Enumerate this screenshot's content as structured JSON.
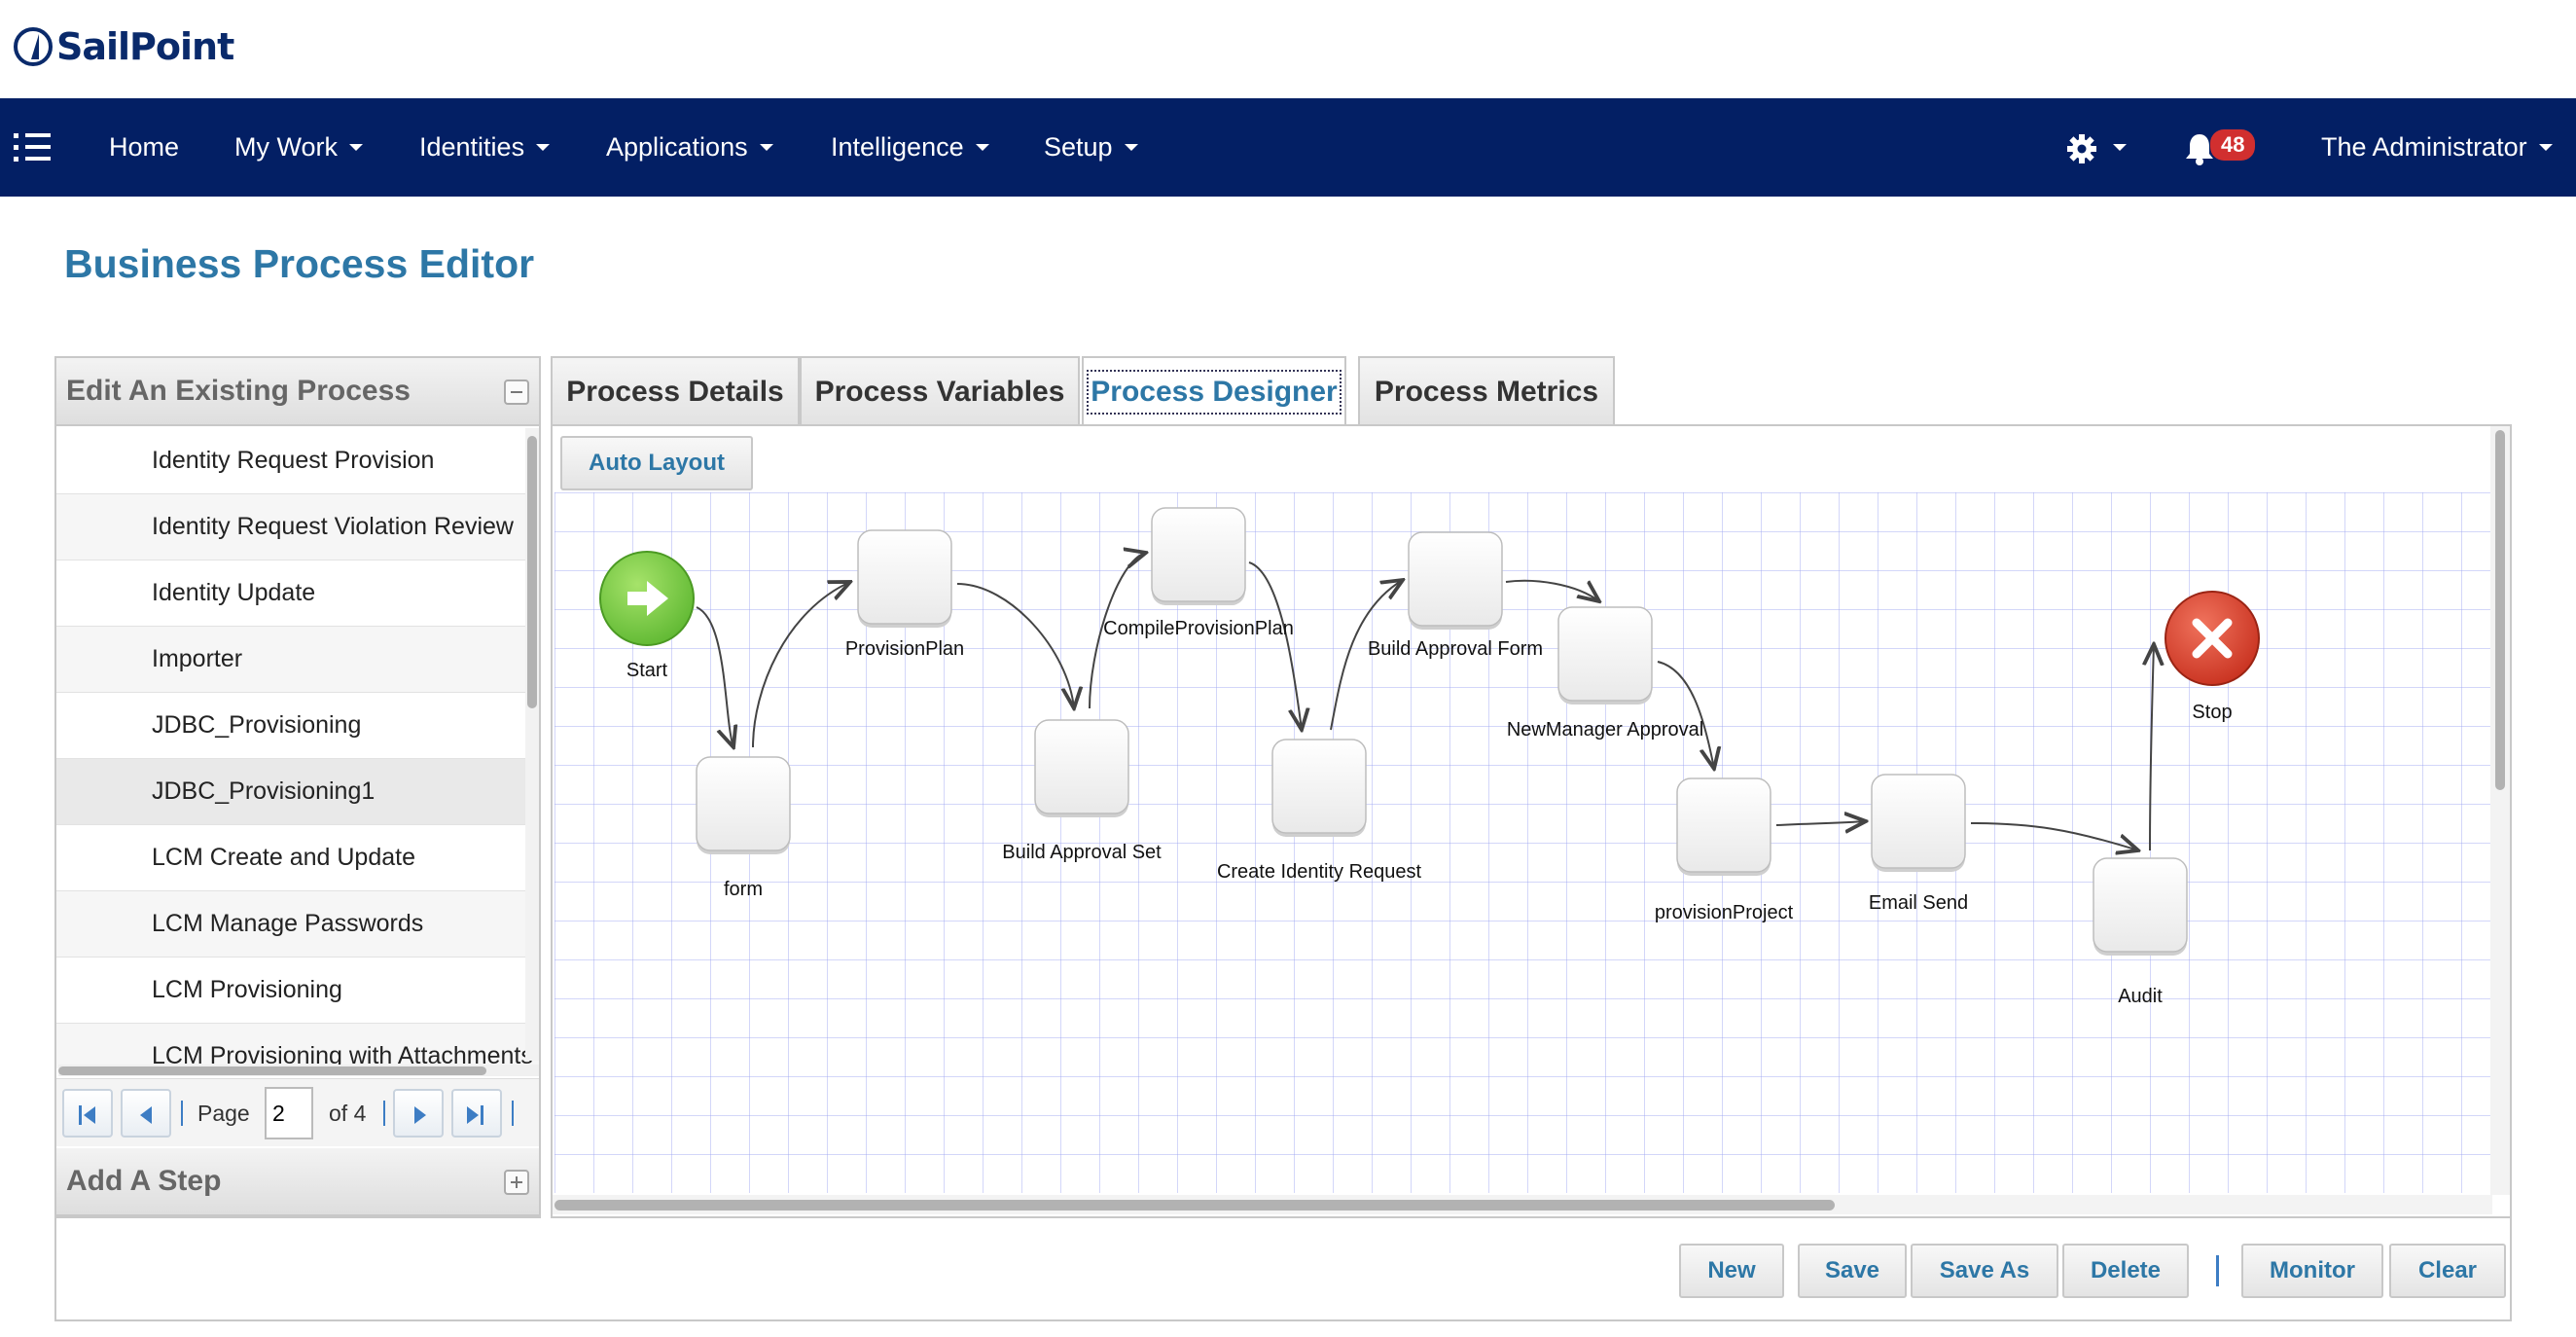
{
  "brand": {
    "name": "SailPoint"
  },
  "nav": {
    "items": [
      {
        "label": "Home",
        "has_dropdown": false
      },
      {
        "label": "My Work",
        "has_dropdown": true
      },
      {
        "label": "Identities",
        "has_dropdown": true
      },
      {
        "label": "Applications",
        "has_dropdown": true
      },
      {
        "label": "Intelligence",
        "has_dropdown": true
      },
      {
        "label": "Setup",
        "has_dropdown": true
      }
    ],
    "notifications_count": "48",
    "user": "The Administrator",
    "icons": [
      "menu-list-icon",
      "gear-icon",
      "bell-icon"
    ]
  },
  "page": {
    "title": "Business Process Editor"
  },
  "left_panel": {
    "edit_header": "Edit An Existing Process",
    "processes": [
      "Identity Request Provision",
      "Identity Request Violation Review",
      "Identity Update",
      "Importer",
      "JDBC_Provisioning",
      "JDBC_Provisioning1",
      "LCM Create and Update",
      "LCM Manage Passwords",
      "LCM Provisioning",
      "LCM Provisioning with Attachments"
    ],
    "selected_index": 5,
    "pager": {
      "page_label": "Page",
      "page_value": "2",
      "of_label": "of 4"
    },
    "add_step_header": "Add A Step"
  },
  "tabs": [
    {
      "label": "Process Details",
      "active": false
    },
    {
      "label": "Process Variables",
      "active": false
    },
    {
      "label": "Process Designer",
      "active": true
    },
    {
      "label": "Process Metrics",
      "active": false
    }
  ],
  "designer": {
    "auto_layout_label": "Auto Layout",
    "colors": {
      "start": "#5fb832",
      "stop": "#c8311f",
      "node": "#e9e9e9",
      "edge": "#444444",
      "grid": "#a9b1f2"
    },
    "steps": [
      {
        "id": "start",
        "label": "Start",
        "kind": "start"
      },
      {
        "id": "form",
        "label": "form",
        "kind": "step"
      },
      {
        "id": "provisionplan",
        "label": "ProvisionPlan",
        "kind": "step"
      },
      {
        "id": "buildapprovalset",
        "label": "Build Approval Set",
        "kind": "step"
      },
      {
        "id": "compileprovisionplan",
        "label": "CompileProvisionPlan",
        "kind": "step"
      },
      {
        "id": "createidentityrequest",
        "label": "Create Identity Request",
        "kind": "step"
      },
      {
        "id": "buildapprovalform",
        "label": "Build Approval Form",
        "kind": "step"
      },
      {
        "id": "newmanagerapproval",
        "label": "NewManager Approval",
        "kind": "step"
      },
      {
        "id": "provisionproject",
        "label": "provisionProject",
        "kind": "step"
      },
      {
        "id": "emailsend",
        "label": "Email Send",
        "kind": "step"
      },
      {
        "id": "audit",
        "label": "Audit",
        "kind": "step"
      },
      {
        "id": "stop",
        "label": "Stop",
        "kind": "stop"
      }
    ],
    "transitions": [
      [
        "start",
        "form"
      ],
      [
        "form",
        "provisionplan"
      ],
      [
        "provisionplan",
        "buildapprovalset"
      ],
      [
        "buildapprovalset",
        "compileprovisionplan"
      ],
      [
        "compileprovisionplan",
        "createidentityrequest"
      ],
      [
        "createidentityrequest",
        "buildapprovalform"
      ],
      [
        "buildapprovalform",
        "newmanagerapproval"
      ],
      [
        "newmanagerapproval",
        "provisionproject"
      ],
      [
        "provisionproject",
        "emailsend"
      ],
      [
        "emailsend",
        "audit"
      ],
      [
        "audit",
        "stop"
      ]
    ]
  },
  "actions": {
    "new": "New",
    "save": "Save",
    "save_as": "Save As",
    "delete": "Delete",
    "monitor": "Monitor",
    "clear": "Clear"
  }
}
